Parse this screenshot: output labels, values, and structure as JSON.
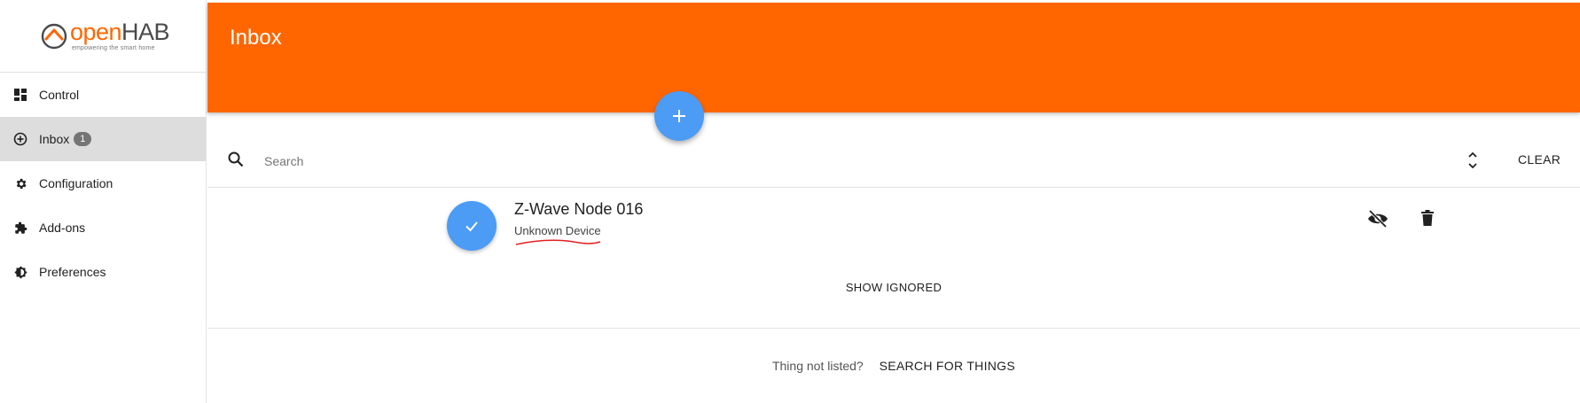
{
  "app": {
    "logo": {
      "word_open": "open",
      "word_hab": "HAB",
      "tagline": "empowering the smart home"
    }
  },
  "sidebar": {
    "items": [
      {
        "label": "Control",
        "icon": "dashboard-icon"
      },
      {
        "label": "Inbox",
        "icon": "add-circle-icon",
        "badge": "1",
        "active": true
      },
      {
        "label": "Configuration",
        "icon": "gear-icon"
      },
      {
        "label": "Add-ons",
        "icon": "puzzle-icon"
      },
      {
        "label": "Preferences",
        "icon": "brightness-icon"
      }
    ]
  },
  "header": {
    "title": "Inbox"
  },
  "search": {
    "placeholder": "Search",
    "value": "",
    "clear_label": "CLEAR"
  },
  "inbox": {
    "items": [
      {
        "title": "Z-Wave Node 016",
        "subtitle": "Unknown Device"
      }
    ],
    "show_ignored_label": "SHOW IGNORED"
  },
  "footer": {
    "question": "Thing not listed?",
    "action": "SEARCH FOR THINGS"
  },
  "colors": {
    "accent": "#ff6600",
    "fab": "#4c9bf5",
    "active_nav": "#dddddd",
    "annotation": "#e02020"
  }
}
